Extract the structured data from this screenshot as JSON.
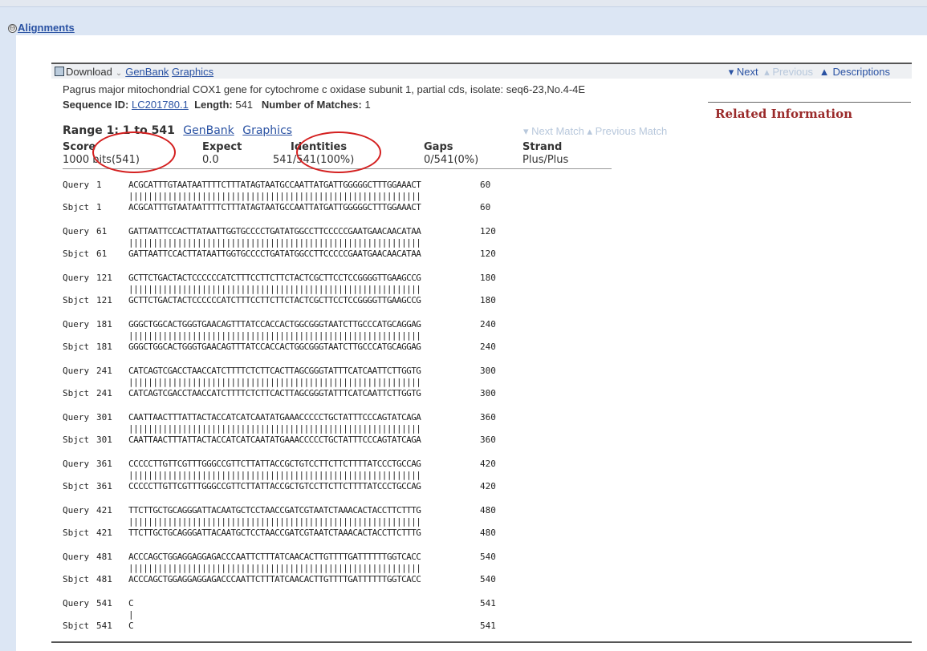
{
  "section": {
    "title": "Alignments",
    "toggle": "⊖"
  },
  "toolbar": {
    "download": "Download",
    "download_sep": "⌄",
    "genbank": "GenBank",
    "graphics": "Graphics",
    "next": "▾ Next",
    "previous": "▴ Previous",
    "descriptions": "Descriptions"
  },
  "hit": {
    "title": "Pagrus major mitochondrial COX1 gene for cytochrome c oxidase subunit 1, partial cds, isolate: seq6-23,No.4-4E",
    "seq_id_label": "Sequence ID:",
    "seq_id": "LC201780.1",
    "length_label": "Length:",
    "length": "541",
    "matches_label": "Number of Matches:",
    "matches": "1"
  },
  "related": {
    "title": "Related Information"
  },
  "range": {
    "label": "Range 1: 1 to 541",
    "genbank": "GenBank",
    "graphics": "Graphics",
    "next_match": "▾ Next Match",
    "prev_match": "▴ Previous Match"
  },
  "score": {
    "headers": [
      "Score",
      "Expect",
      "Identities",
      "Gaps",
      "Strand"
    ],
    "values": [
      "1000 bits(541)",
      "0.0",
      "541/541(100%)",
      "0/541(0%)",
      "Plus/Plus"
    ]
  },
  "alignment": [
    {
      "qlabel": "Query",
      "qstart": "1",
      "qseq": "ACGCATTTGTAATAATTTTCTTTATAGTAATGCCAATTATGATTGGGGGCTTTGGAAACT",
      "qend": "60",
      "slabel": "Sbjct",
      "sstart": "1",
      "sseq": "ACGCATTTGTAATAATTTTCTTTATAGTAATGCCAATTATGATTGGGGGCTTTGGAAACT",
      "send": "60"
    },
    {
      "qlabel": "Query",
      "qstart": "61",
      "qseq": "GATTAATTCCACTTATAATTGGTGCCCCTGATATGGCCTTCCCCCGAATGAACAACATAA",
      "qend": "120",
      "slabel": "Sbjct",
      "sstart": "61",
      "sseq": "GATTAATTCCACTTATAATTGGTGCCCCTGATATGGCCTTCCCCCGAATGAACAACATAA",
      "send": "120"
    },
    {
      "qlabel": "Query",
      "qstart": "121",
      "qseq": "GCTTCTGACTACTCCCCCCATCTTTCCTTCTTCTACTCGCTTCCTCCGGGGTTGAAGCCG",
      "qend": "180",
      "slabel": "Sbjct",
      "sstart": "121",
      "sseq": "GCTTCTGACTACTCCCCCCATCTTTCCTTCTTCTACTCGCTTCCTCCGGGGTTGAAGCCG",
      "send": "180"
    },
    {
      "qlabel": "Query",
      "qstart": "181",
      "qseq": "GGGCTGGCACTGGGTGAACAGTTTATCCACCACTGGCGGGTAATCTTGCCCATGCAGGAG",
      "qend": "240",
      "slabel": "Sbjct",
      "sstart": "181",
      "sseq": "GGGCTGGCACTGGGTGAACAGTTTATCCACCACTGGCGGGTAATCTTGCCCATGCAGGAG",
      "send": "240"
    },
    {
      "qlabel": "Query",
      "qstart": "241",
      "qseq": "CATCAGTCGACCTAACCATCTTTTCTCTTCACTTAGCGGGTATTTCATCAATTCTTGGTG",
      "qend": "300",
      "slabel": "Sbjct",
      "sstart": "241",
      "sseq": "CATCAGTCGACCTAACCATCTTTTCTCTTCACTTAGCGGGTATTTCATCAATTCTTGGTG",
      "send": "300"
    },
    {
      "qlabel": "Query",
      "qstart": "301",
      "qseq": "CAATTAACTTTATTACTACCATCATCAATATGAAACCCCCTGCTATTTCCCAGTATCAGA",
      "qend": "360",
      "slabel": "Sbjct",
      "sstart": "301",
      "sseq": "CAATTAACTTTATTACTACCATCATCAATATGAAACCCCCTGCTATTTCCCAGTATCAGA",
      "send": "360"
    },
    {
      "qlabel": "Query",
      "qstart": "361",
      "qseq": "CCCCCTTGTTCGTTTGGGCCGTTCTTATTACCGCTGTCCTTCTTCTTTTATCCCTGCCAG",
      "qend": "420",
      "slabel": "Sbjct",
      "sstart": "361",
      "sseq": "CCCCCTTGTTCGTTTGGGCCGTTCTTATTACCGCTGTCCTTCTTCTTTTATCCCTGCCAG",
      "send": "420"
    },
    {
      "qlabel": "Query",
      "qstart": "421",
      "qseq": "TTCTTGCTGCAGGGATTACAATGCTCCTAACCGATCGTAATCTAAACACTACCTTCTTTG",
      "qend": "480",
      "slabel": "Sbjct",
      "sstart": "421",
      "sseq": "TTCTTGCTGCAGGGATTACAATGCTCCTAACCGATCGTAATCTAAACACTACCTTCTTTG",
      "send": "480"
    },
    {
      "qlabel": "Query",
      "qstart": "481",
      "qseq": "ACCCAGCTGGAGGAGGAGACCCAATTCTTTATCAACACTTGTTTTGATTTTTTGGTCACC",
      "qend": "540",
      "slabel": "Sbjct",
      "sstart": "481",
      "sseq": "ACCCAGCTGGAGGAGGAGACCCAATTCTTTATCAACACTTGTTTTGATTTTTTGGTCACC",
      "send": "540"
    },
    {
      "qlabel": "Query",
      "qstart": "541",
      "qseq": "C",
      "qend": "541",
      "slabel": "Sbjct",
      "sstart": "541",
      "sseq": "C",
      "send": "541"
    }
  ],
  "colors": {
    "link": "#2a52a3",
    "related": "#9a2a2a",
    "annotation": "#d42020",
    "band": "#dce6f4"
  },
  "icons": [
    "collapse-icon",
    "download-icon",
    "descriptions-icon"
  ]
}
